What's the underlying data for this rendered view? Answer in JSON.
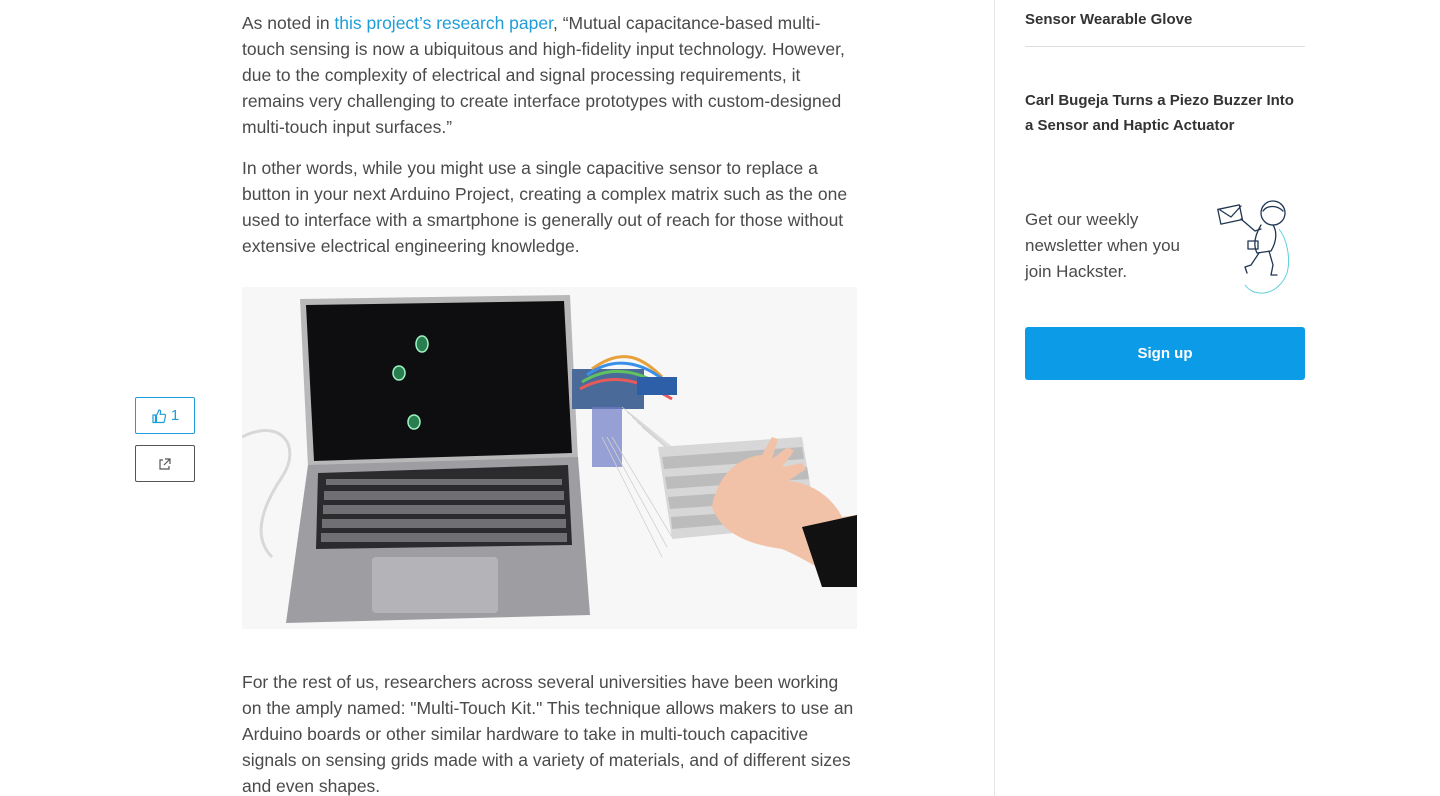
{
  "article": {
    "p1_prefix": "As noted in ",
    "p1_link": "this project’s research paper",
    "p1_suffix": ", “Mutual capacitance-based multi-touch sensing is now a ubiquitous and high-fidelity input technology. However, due to the complexity of electrical and signal processing requirements, it remains very challenging to create interface prototypes with custom-designed multi-touch input surfaces.”",
    "p2": "In other words, while you might use a single capacitive sensor to replace a button in your next Arduino Project, creating a complex matrix such as the one used to interface with a smartphone is generally out of reach for those without extensive electrical engineering knowledge.",
    "p3": "For the rest of us, researchers across several universities have been working on the amply named: \"Multi-Touch Kit.\" This technique allows makers to use an Arduino boards or other similar hardware to take in multi-touch capacitive signals on sensing grids made with a variety of materials, and of different sizes and even shapes."
  },
  "social": {
    "like_count": "1",
    "like_icon": "thumbs-up-icon",
    "share_icon": "share-icon"
  },
  "sidebar": {
    "related": [
      "Hand Mimics the Movement of a Tinfoil Sensor Wearable Glove",
      "Carl Bugeja Turns a Piezo Buzzer Into a Sensor and Haptic Actuator"
    ],
    "newsletter_text": "Get our weekly newsletter when you join Hackster.",
    "signup_label": "Sign up"
  },
  "colors": {
    "link": "#1e9dd8",
    "button": "#0c9be6",
    "text": "#4a4a4a"
  }
}
